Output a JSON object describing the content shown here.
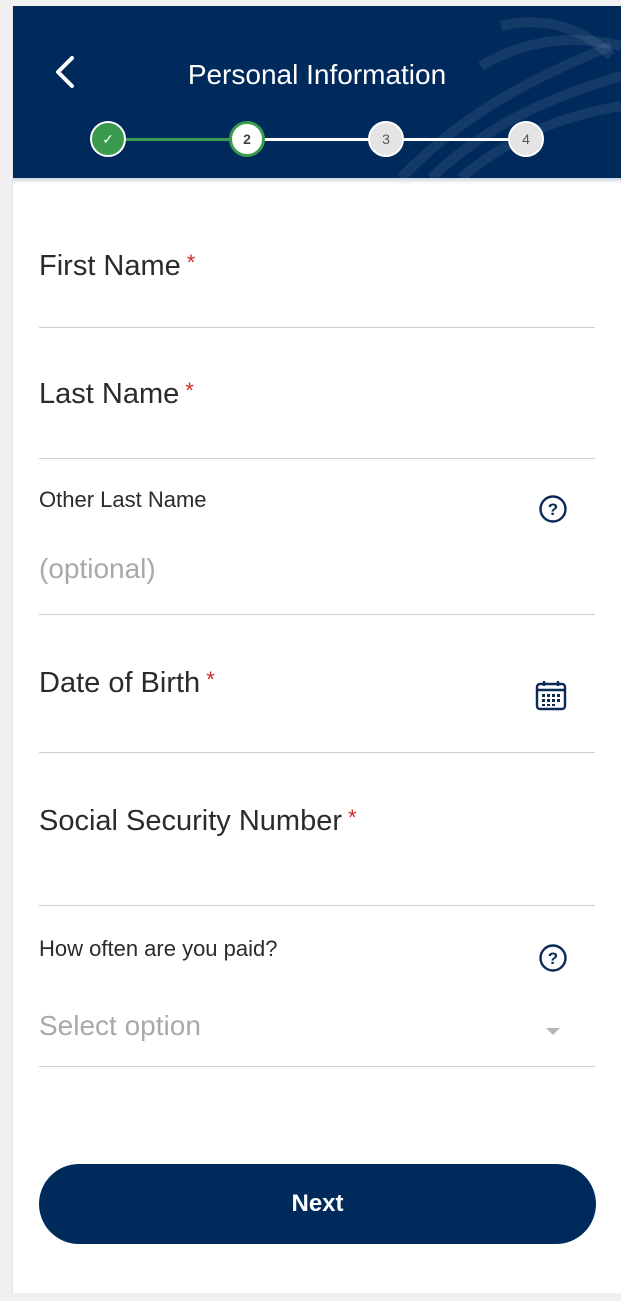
{
  "header": {
    "title": "Personal Information",
    "steps": [
      {
        "label": "✓",
        "state": "done"
      },
      {
        "label": "2",
        "state": "current"
      },
      {
        "label": "3",
        "state": "todo"
      },
      {
        "label": "4",
        "state": "todo"
      }
    ]
  },
  "form": {
    "first_name": {
      "label": "First Name",
      "required_mark": "*"
    },
    "last_name": {
      "label": "Last Name",
      "required_mark": "*"
    },
    "other_last_name": {
      "label": "Other Last Name",
      "placeholder": "(optional)"
    },
    "date_of_birth": {
      "label": "Date of Birth",
      "required_mark": "*"
    },
    "ssn": {
      "label": "Social Security Number",
      "required_mark": "*"
    },
    "pay_frequency": {
      "label": "How often are you paid?",
      "placeholder": "Select option"
    }
  },
  "actions": {
    "next_label": "Next"
  },
  "colors": {
    "header_bg": "#002a5c",
    "step_done": "#3a9a4e",
    "required": "#d22b2b",
    "primary_button": "#002a5c"
  },
  "icons": [
    "chevron-left-icon",
    "check-icon",
    "help-circle-icon",
    "calendar-icon",
    "caret-down-icon"
  ]
}
